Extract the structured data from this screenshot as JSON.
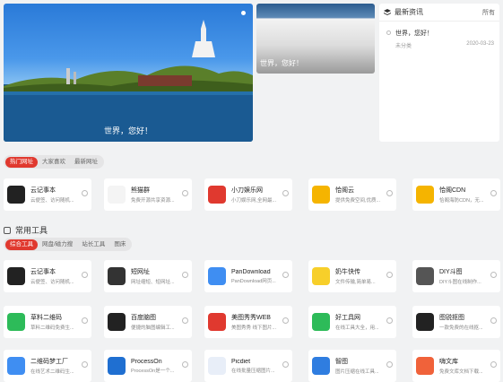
{
  "hero": {
    "big_caption": "世界，您好！",
    "small_caption": "世界，您好！"
  },
  "news": {
    "title": "最新资讯",
    "more": "所有",
    "items": [
      {
        "title": "世界，您好！",
        "category": "未分类",
        "date": "2020-03-23"
      }
    ]
  },
  "hot_tabs": [
    "热门网址",
    "大家喜欢",
    "最新网址"
  ],
  "hot_cards": [
    {
      "name": "云记事本",
      "desc": "云便签、访问随机...",
      "icon": "pen-icon",
      "color": "#222"
    },
    {
      "name": "熊猫群",
      "desc": "免费开源共享资源...",
      "icon": "panda-icon",
      "color": "#f4f4f4"
    },
    {
      "name": "小刀娱乐网",
      "desc": "小刀娱乐网,全网最...",
      "icon": "xd-logo-icon",
      "color": "#e0392f"
    },
    {
      "name": "恰阁云",
      "desc": "提供免费空间,优质...",
      "icon": "stack-icon",
      "color": "#f5b400"
    },
    {
      "name": "恰阁CDN",
      "desc": "恰阁海防CDN，无...",
      "icon": "stack-icon",
      "color": "#f5b400"
    }
  ],
  "common": {
    "title": "常用工具",
    "tabs": [
      "综合工具",
      "网盘/磁力搜",
      "站长工具",
      "图床"
    ],
    "cards": [
      {
        "name": "云记事本",
        "desc": "云便签、访问随机...",
        "icon": "pen-icon",
        "color": "#222"
      },
      {
        "name": "短网址",
        "desc": "网址缩短、短网址...",
        "icon": "link-icon",
        "color": "#333"
      },
      {
        "name": "PanDownload",
        "desc": "PanDownload网页...",
        "icon": "cloud-icon",
        "color": "#3f8ef2"
      },
      {
        "name": "奶牛快传",
        "desc": "文件传输,简单易...",
        "icon": "cow-icon",
        "color": "#f7cf2a"
      },
      {
        "name": "DIY斗图",
        "desc": "DIY斗图在线制作...",
        "icon": "face-icon",
        "color": "#555"
      },
      {
        "name": "草料二维码",
        "desc": "草料二维码免费生...",
        "icon": "qr-icon",
        "color": "#2dbb59"
      },
      {
        "name": "百度脑图",
        "desc": "便捷的脑图编辑工...",
        "icon": "mindmap-icon",
        "color": "#222"
      },
      {
        "name": "美图秀秀WEB",
        "desc": "美图秀秀 线下图片...",
        "icon": "meitu-icon",
        "color": "#e0392f"
      },
      {
        "name": "好工具网",
        "desc": "在线工具大全，用...",
        "icon": "tools-icon",
        "color": "#2dbb59"
      },
      {
        "name": "图锐抠图",
        "desc": "一款免费的在线抠...",
        "icon": "picsee-icon",
        "color": "#222"
      },
      {
        "name": "二维码梦工厂",
        "desc": "在线艺术二维码生...",
        "icon": "qr-art-icon",
        "color": "#3f8ef2"
      },
      {
        "name": "ProcessOn",
        "desc": "ProcessOn是一个...",
        "icon": "on-icon",
        "color": "#1f6fd1"
      },
      {
        "name": "Picdiet",
        "desc": "在线批量压缩图片...",
        "icon": "picdiet-icon",
        "color": "#e8eef8"
      },
      {
        "name": "智图",
        "desc": "图片压缩在线工具...",
        "icon": "zhitu-icon",
        "color": "#2f7de0"
      },
      {
        "name": "嗨文库",
        "desc": "免费文库文档下载...",
        "icon": "hi-icon",
        "color": "#f0623a"
      }
    ]
  }
}
